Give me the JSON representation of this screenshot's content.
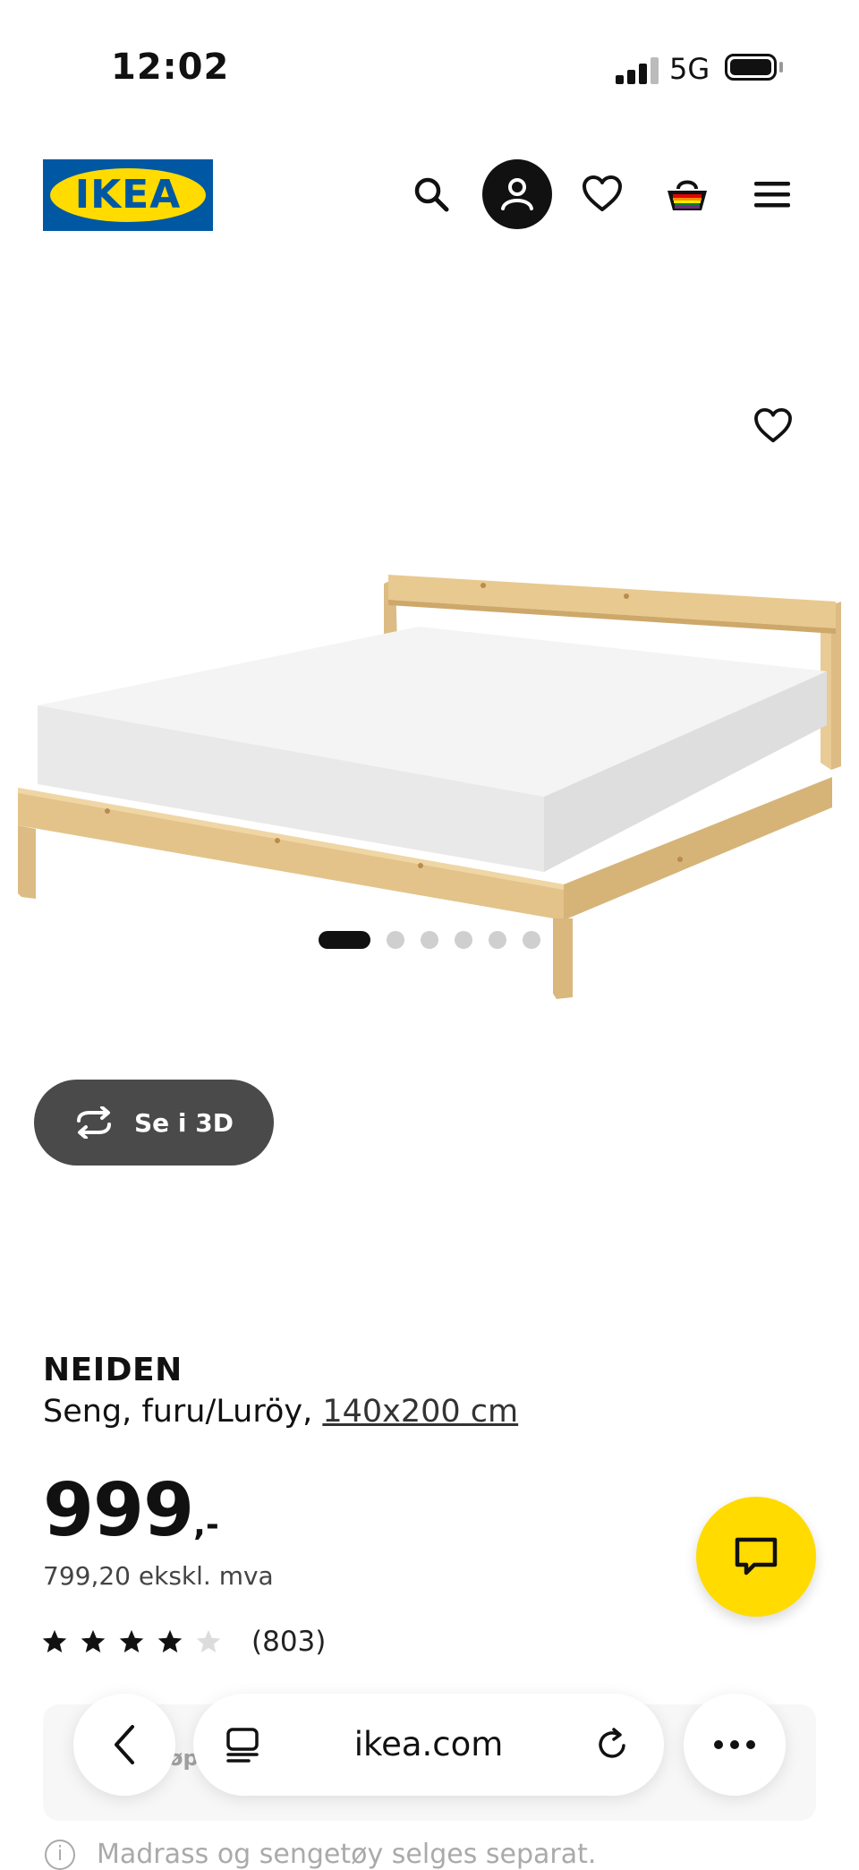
{
  "status": {
    "time": "12:02",
    "network": "5G"
  },
  "header": {
    "logo_text": "IKEA",
    "icons": [
      "search-icon",
      "user-icon",
      "heart-icon",
      "basket-icon",
      "menu-icon"
    ]
  },
  "gallery": {
    "button_3d": "Se i 3D",
    "image_count": 6,
    "active_image": 1
  },
  "product": {
    "name": "NEIDEN",
    "description": "Seng, furu/Luröy, ",
    "size_link": "140x200 cm",
    "price_main": "999",
    "price_decimals": ",-",
    "price_ex_vat": "799,20 ekskl. mva",
    "rating_value": 4,
    "rating_max": 5,
    "review_count": "(803)"
  },
  "below_fold": {
    "card_partial_text": "øp",
    "notice": "Madrass og sengetøy selges separat."
  },
  "browser": {
    "domain": "ikea.com"
  },
  "colors": {
    "ikea_blue": "#0058a3",
    "ikea_yellow": "#ffdb00",
    "dark_button": "#4a4a4a"
  }
}
